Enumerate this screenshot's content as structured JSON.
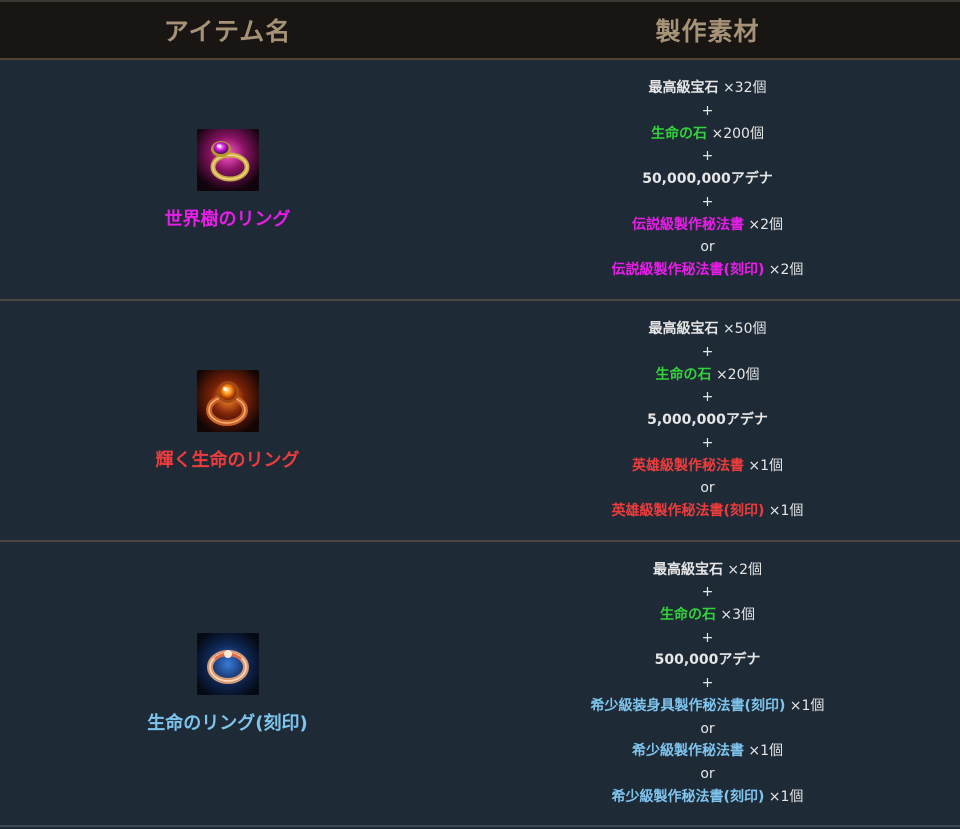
{
  "header": {
    "col_item": "アイテム名",
    "col_materials": "製作素材"
  },
  "colors": {
    "white": "#e6e6e6",
    "green": "#34d23a",
    "magenta": "#e81ee8",
    "red": "#ee3c3c",
    "blue": "#7ec5ee"
  },
  "rows": [
    {
      "item": {
        "name": "世界樹のリング",
        "icon": "magenta-gem-ring-icon",
        "color": "#e81ee8"
      },
      "materials": [
        {
          "name": "最高級宝石",
          "qty": "×32個",
          "color": "#e6e6e6"
        },
        {
          "sep": "+"
        },
        {
          "name": "生命の石",
          "qty": "×200個",
          "color": "#34d23a"
        },
        {
          "sep": "+"
        },
        {
          "name": "50,000,000アデナ",
          "qty": "",
          "color": "#e6e6e6"
        },
        {
          "sep": "+"
        },
        {
          "name": "伝説級製作秘法書",
          "qty": "×2個",
          "color": "#e81ee8"
        },
        {
          "sep": "or"
        },
        {
          "name": "伝説級製作秘法書(刻印)",
          "qty": "×2個",
          "color": "#e81ee8"
        }
      ]
    },
    {
      "item": {
        "name": "輝く生命のリング",
        "icon": "orange-gem-ring-icon",
        "color": "#ee3c3c"
      },
      "materials": [
        {
          "name": "最高級宝石",
          "qty": "×50個",
          "color": "#e6e6e6"
        },
        {
          "sep": "+"
        },
        {
          "name": "生命の石",
          "qty": "×20個",
          "color": "#34d23a"
        },
        {
          "sep": "+"
        },
        {
          "name": "5,000,000アデナ",
          "qty": "",
          "color": "#e6e6e6"
        },
        {
          "sep": "+"
        },
        {
          "name": "英雄級製作秘法書",
          "qty": "×1個",
          "color": "#ee3c3c"
        },
        {
          "sep": "or"
        },
        {
          "name": "英雄級製作秘法書(刻印)",
          "qty": "×1個",
          "color": "#ee3c3c"
        }
      ]
    },
    {
      "item": {
        "name": "生命のリング(刻印)",
        "icon": "blue-glow-ring-icon",
        "color": "#7ec5ee"
      },
      "materials": [
        {
          "name": "最高級宝石",
          "qty": "×2個",
          "color": "#e6e6e6"
        },
        {
          "sep": "+"
        },
        {
          "name": "生命の石",
          "qty": "×3個",
          "color": "#34d23a"
        },
        {
          "sep": "+"
        },
        {
          "name": "500,000アデナ",
          "qty": "",
          "color": "#e6e6e6"
        },
        {
          "sep": "+"
        },
        {
          "name": "希少級装身具製作秘法書(刻印)",
          "qty": "×1個",
          "color": "#7ec5ee"
        },
        {
          "sep": "or"
        },
        {
          "name": "希少級製作秘法書",
          "qty": "×1個",
          "color": "#7ec5ee"
        },
        {
          "sep": "or"
        },
        {
          "name": "希少級製作秘法書(刻印)",
          "qty": "×1個",
          "color": "#7ec5ee"
        }
      ]
    }
  ]
}
